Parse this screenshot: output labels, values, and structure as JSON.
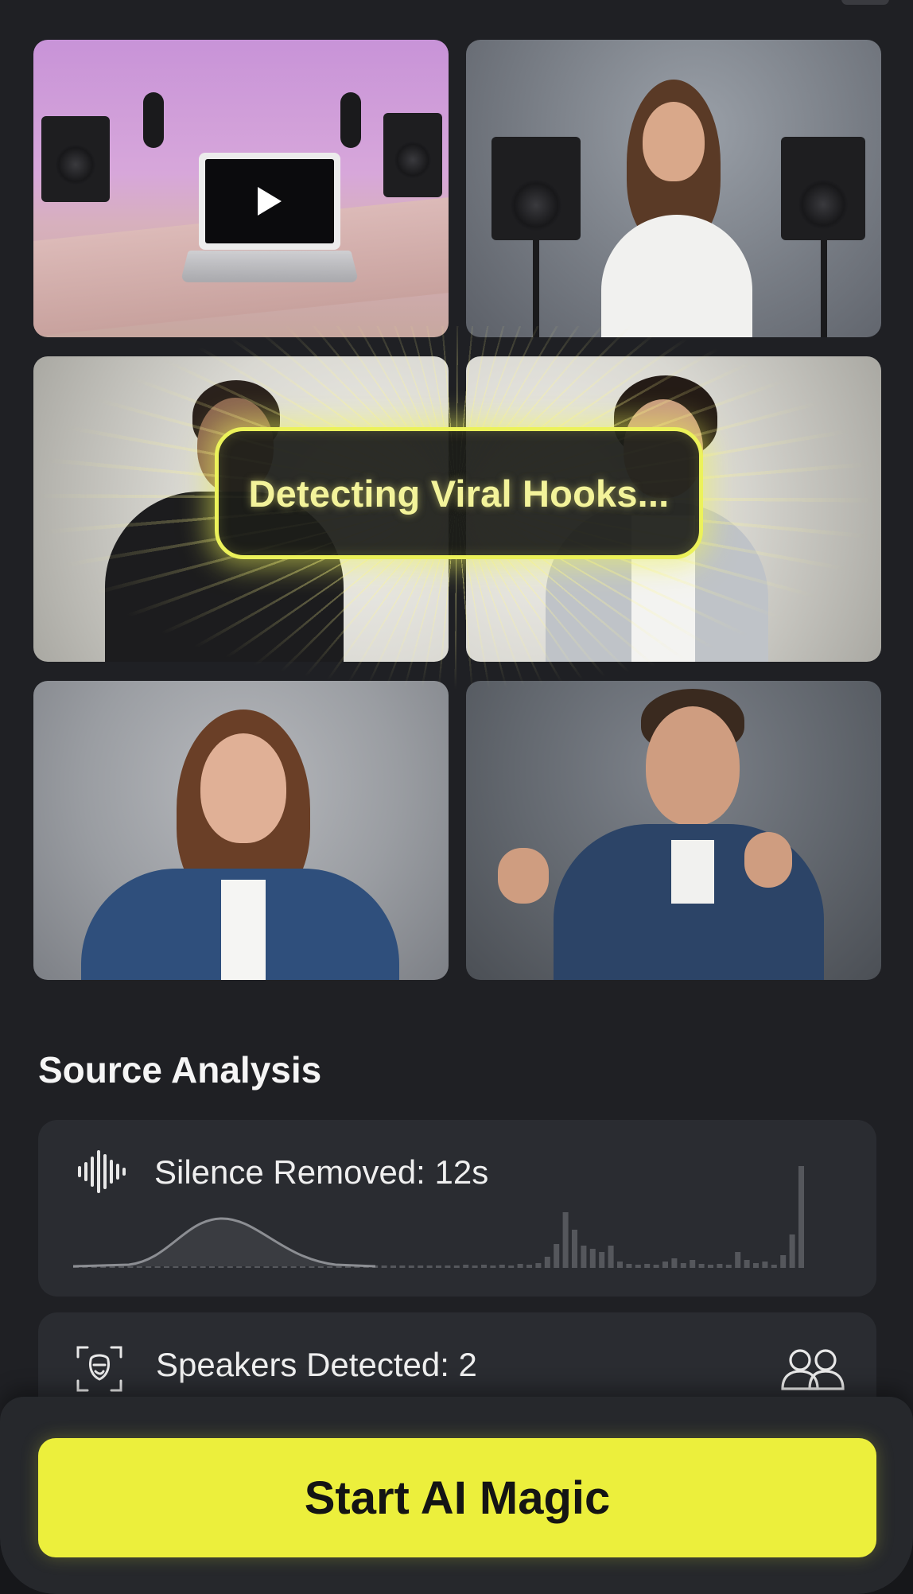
{
  "video_grid": {
    "tiles": [
      {
        "id": "podcast-setup",
        "has_play": true
      },
      {
        "id": "woman-speakers"
      },
      {
        "id": "host-left"
      },
      {
        "id": "host-right"
      },
      {
        "id": "woman-denim"
      },
      {
        "id": "man-denim"
      }
    ],
    "status_overlay": "Detecting Viral Hooks...",
    "accent_color": "#ecf25a"
  },
  "analysis": {
    "title": "Source Analysis",
    "silence": {
      "label": "Silence Removed: 12s",
      "icon": "waveform-icon"
    },
    "speakers": {
      "label": "Speakers Detected: 2",
      "icon": "face-scan-icon",
      "trailing_icon": "people-icon"
    }
  },
  "cta": {
    "label": "Start AI Magic",
    "color": "#ecef3c"
  }
}
